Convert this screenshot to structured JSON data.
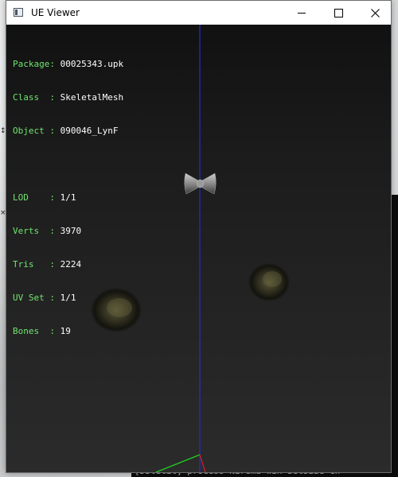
{
  "window": {
    "title": "UE Viewer",
    "minimize_label": "—",
    "maximize_label": "☐",
    "close_label": "✕"
  },
  "info": {
    "package": {
      "label": "Package: ",
      "value": "00025343.upk"
    },
    "class": {
      "label": "Class  : ",
      "value": "SkeletalMesh"
    },
    "object": {
      "label": "Object : ",
      "value": "090046_LynF"
    },
    "lod": {
      "label": "LOD    : ",
      "value": "1/1"
    },
    "verts": {
      "label": "Verts  : ",
      "value": "3970"
    },
    "tris": {
      "label": "Tris   : ",
      "value": "2224"
    },
    "uvset": {
      "label": "UV Set : ",
      "value": "1/1"
    },
    "bones": {
      "label": "Bones  : ",
      "value": "19"
    }
  },
  "console": {
    "bottom_line": "[DStetil] process  Nirema win SetSize  Ch"
  },
  "colors": {
    "label_green": "#6ee66e",
    "axis_blue": "#1f2fd6",
    "axis_green": "#1fd11f",
    "axis_red": "#d11f1f"
  }
}
